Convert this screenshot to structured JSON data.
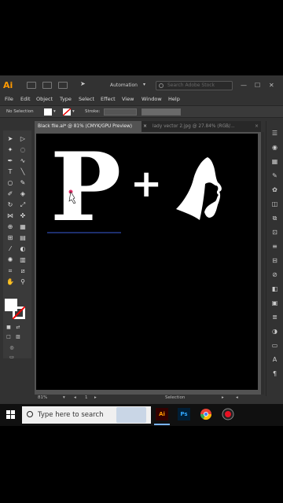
{
  "app": {
    "logo": "Ai",
    "workspace": "Automation",
    "search_placeholder": "Search Adobe Stock",
    "window_controls": {
      "minimize": "—",
      "maximize": "☐",
      "close": "✕"
    }
  },
  "menubar": [
    "File",
    "Edit",
    "Object",
    "Type",
    "Select",
    "Effect",
    "View",
    "Window",
    "Help"
  ],
  "controlbar": {
    "selection_label": "No Selection",
    "stroke_label": "Stroke:",
    "fill_color": "#ffffff"
  },
  "tabs": [
    {
      "label": "Black file.ai* @ 81% (CMYK/GPU Preview)",
      "active": true
    },
    {
      "label": "lady vector 2.jpg @ 27.84% (RGB/...",
      "active": false
    }
  ],
  "tab_close_glyph": "×",
  "canvas": {
    "letter": "P",
    "plus": "+",
    "artboard_color": "#000000",
    "art_color": "#ffffff"
  },
  "statusbar": {
    "zoom": "81%",
    "page": "1",
    "tool": "Selection"
  },
  "taskbar": {
    "search_placeholder": "Type here to search",
    "apps": [
      {
        "name": "illustrator",
        "label": "Ai",
        "color": "#ff9a00",
        "bg": "#330000",
        "active": true
      },
      {
        "name": "photoshop",
        "label": "Ps",
        "color": "#31a8ff",
        "bg": "#001e36",
        "active": false
      },
      {
        "name": "chrome",
        "label": "",
        "color": "#ea4335",
        "bg": "transparent",
        "active": false
      },
      {
        "name": "recorder",
        "label": "",
        "color": "#e81123",
        "bg": "transparent",
        "active": false
      }
    ]
  }
}
